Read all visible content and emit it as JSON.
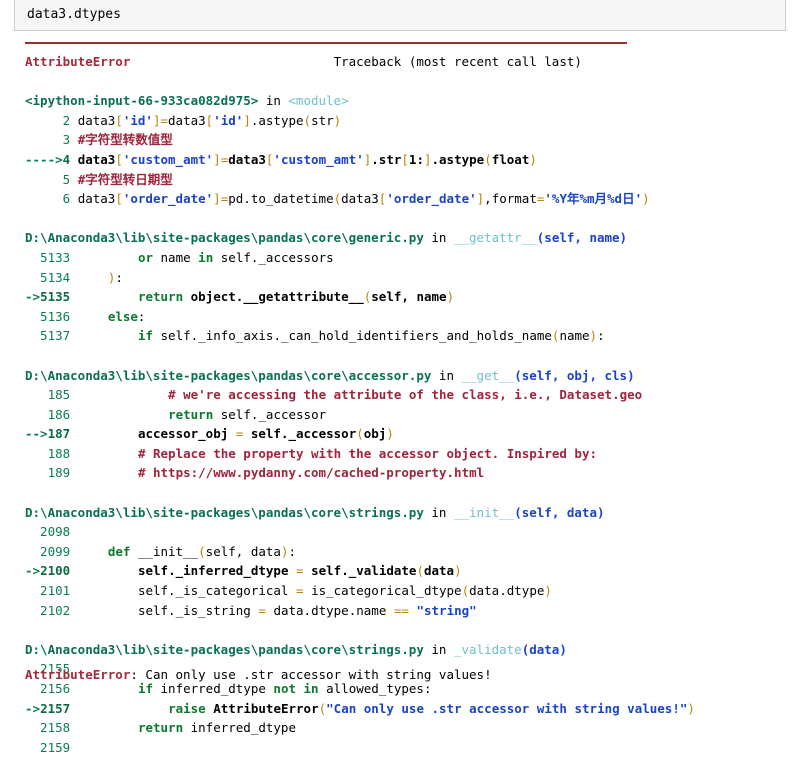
{
  "input_cell": {
    "code": "data3.dtypes"
  },
  "error": {
    "type": "AttributeError",
    "traceback_label": "Traceback (most recent call last)",
    "final_message": "Can only use .str accessor with string values!"
  },
  "frames": [
    {
      "location": "<ipython-input-66-933ca082d975>",
      "in_word": "in",
      "function": "<module>",
      "args": "",
      "lines": [
        {
          "marker": "",
          "number": "2",
          "code": "data3['id']=data3['id'].astype(str)"
        },
        {
          "marker": "",
          "number": "3",
          "code": "#字符型转数值型"
        },
        {
          "marker": "----> ",
          "number": "4",
          "code": "data3['custom_amt']=data3['custom_amt'].str[1:].astype(float)"
        },
        {
          "marker": "",
          "number": "5",
          "code": "#字符型转日期型"
        },
        {
          "marker": "",
          "number": "6",
          "code": "data3['order_date']=pd.to_datetime(data3['order_date'],format='%Y年%m月%d日')"
        }
      ]
    },
    {
      "location": "D:\\Anaconda3\\lib\\site-packages\\pandas\\core\\generic.py",
      "in_word": "in",
      "function": "__getattr__",
      "args": "(self, name)",
      "lines": [
        {
          "marker": "",
          "number": "5133",
          "code": "        or name in self._accessors"
        },
        {
          "marker": "",
          "number": "5134",
          "code": "    ):"
        },
        {
          "marker": "-> ",
          "number": "5135",
          "code": "        return object.__getattribute__(self, name)"
        },
        {
          "marker": "",
          "number": "5136",
          "code": "    else:"
        },
        {
          "marker": "",
          "number": "5137",
          "code": "        if self._info_axis._can_hold_identifiers_and_holds_name(name):"
        }
      ]
    },
    {
      "location": "D:\\Anaconda3\\lib\\site-packages\\pandas\\core\\accessor.py",
      "in_word": "in",
      "function": "__get__",
      "args": "(self, obj, cls)",
      "lines": [
        {
          "marker": "",
          "number": "185",
          "code": "            # we're accessing the attribute of the class, i.e., Dataset.geo"
        },
        {
          "marker": "",
          "number": "186",
          "code": "            return self._accessor"
        },
        {
          "marker": "--> ",
          "number": "187",
          "code": "        accessor_obj = self._accessor(obj)"
        },
        {
          "marker": "",
          "number": "188",
          "code": "        # Replace the property with the accessor object. Inspired by:"
        },
        {
          "marker": "",
          "number": "189",
          "code": "        # https://www.pydanny.com/cached-property.html"
        }
      ]
    },
    {
      "location": "D:\\Anaconda3\\lib\\site-packages\\pandas\\core\\strings.py",
      "in_word": "in",
      "function": "__init__",
      "args": "(self, data)",
      "lines": [
        {
          "marker": "",
          "number": "2098",
          "code": ""
        },
        {
          "marker": "",
          "number": "2099",
          "code": "    def __init__(self, data):"
        },
        {
          "marker": "-> ",
          "number": "2100",
          "code": "        self._inferred_dtype = self._validate(data)"
        },
        {
          "marker": "",
          "number": "2101",
          "code": "        self._is_categorical = is_categorical_dtype(data.dtype)"
        },
        {
          "marker": "",
          "number": "2102",
          "code": "        self._is_string = data.dtype.name == \"string\""
        }
      ]
    },
    {
      "location": "D:\\Anaconda3\\lib\\site-packages\\pandas\\core\\strings.py",
      "in_word": "in",
      "function": "_validate",
      "args": "(data)",
      "lines": [
        {
          "marker": "",
          "number": "2155",
          "code": ""
        },
        {
          "marker": "",
          "number": "2156",
          "code": "        if inferred_dtype not in allowed_types:"
        },
        {
          "marker": "-> ",
          "number": "2157",
          "code": "            raise AttributeError(\"Can only use .str accessor with string values!\")"
        },
        {
          "marker": "",
          "number": "2158",
          "code": "        return inferred_dtype"
        },
        {
          "marker": "",
          "number": "2159",
          "code": ""
        }
      ]
    }
  ],
  "colors": {
    "error_red": "#a02c3c",
    "file_green": "#0a7055",
    "string_blue": "#1a43c8",
    "comment_red": "#a0243c",
    "operator_orange": "#b8860b",
    "rule_red": "#a02c2c",
    "cell_bg": "#f7f7f7",
    "cell_border": "#cfcfcf"
  }
}
